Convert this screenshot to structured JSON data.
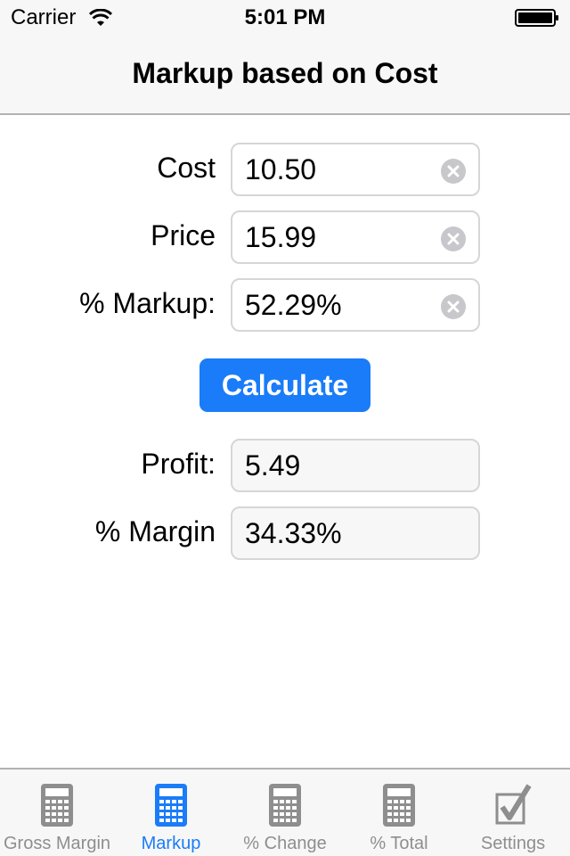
{
  "status": {
    "carrier": "Carrier",
    "time": "5:01 PM"
  },
  "nav": {
    "title": "Markup based on Cost"
  },
  "form": {
    "cost": {
      "label": "Cost",
      "value": "10.50"
    },
    "price": {
      "label": "Price",
      "value": "15.99"
    },
    "markup": {
      "label": "% Markup:",
      "value": "52.29%"
    },
    "calculate_label": "Calculate",
    "profit": {
      "label": "Profit:",
      "value": "5.49"
    },
    "margin": {
      "label": "% Margin",
      "value": "34.33%"
    }
  },
  "tabs": [
    {
      "label": "Gross Margin",
      "icon": "calculator-icon"
    },
    {
      "label": "Markup",
      "icon": "calculator-icon",
      "active": true
    },
    {
      "label": "% Change",
      "icon": "calculator-icon"
    },
    {
      "label": "% Total",
      "icon": "calculator-icon"
    },
    {
      "label": "Settings",
      "icon": "checkbox-icon"
    }
  ],
  "colors": {
    "accent": "#1a7cf8",
    "inactive": "#8e8e8e",
    "bar": "#f7f7f7"
  }
}
